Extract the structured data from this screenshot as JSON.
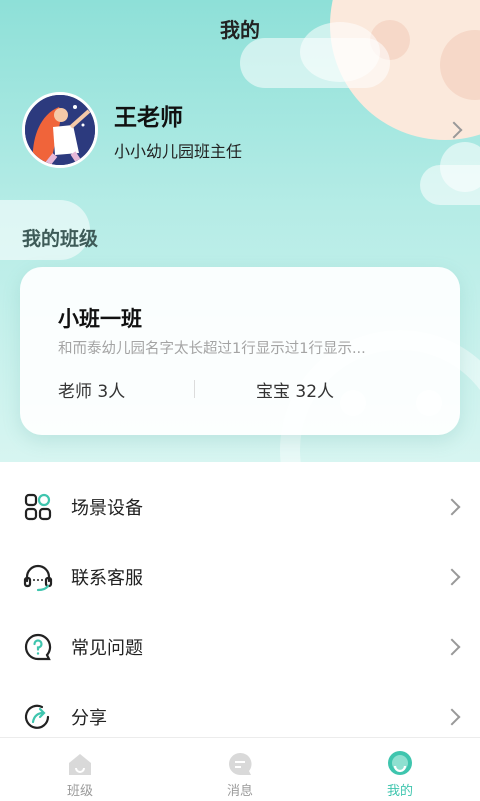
{
  "header": {
    "title": "我的"
  },
  "profile": {
    "name": "王老师",
    "role": "小小幼儿园班主任"
  },
  "my_class": {
    "section_title": "我的班级",
    "class_name": "小班一班",
    "school": "和而泰幼儿园名字太长超过1行显示过1行显示...",
    "teachers": "老师 3人",
    "babies": "宝宝 32人"
  },
  "menu": {
    "items": [
      {
        "label": "场景设备",
        "icon": "grid-apps-icon"
      },
      {
        "label": "联系客服",
        "icon": "headset-icon"
      },
      {
        "label": "常见问题",
        "icon": "question-bubble-icon"
      },
      {
        "label": "分享",
        "icon": "share-icon"
      }
    ]
  },
  "tabbar": {
    "tabs": [
      {
        "label": "班级",
        "icon": "house-icon"
      },
      {
        "label": "消息",
        "icon": "message-icon"
      },
      {
        "label": "我的",
        "icon": "profile-icon"
      }
    ],
    "active": 2,
    "active_color": "#3fc5ae"
  },
  "colors": {
    "accent": "#3fc5ae",
    "hero": "#8ee0d8"
  }
}
